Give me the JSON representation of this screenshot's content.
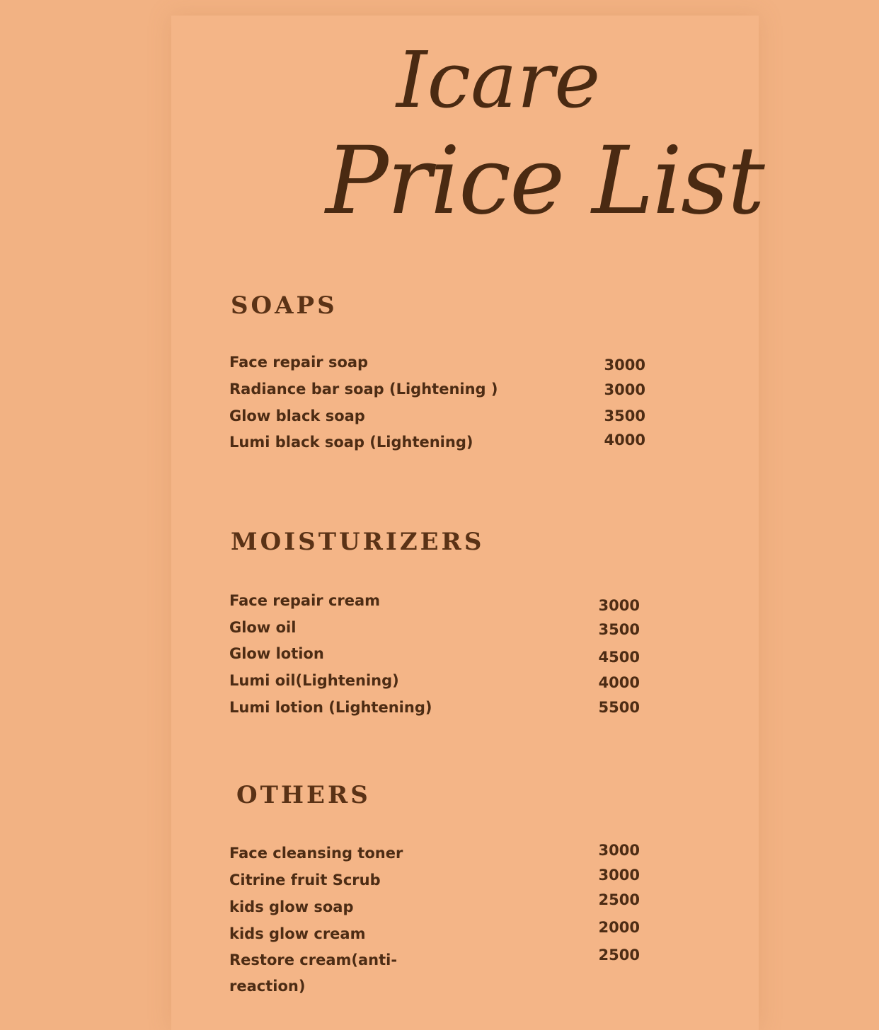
{
  "header": {
    "brand": "Icare",
    "title": "Price List"
  },
  "sections": [
    {
      "title": "SOAPS",
      "items": [
        {
          "name": "Face repair soap",
          "price": "3000"
        },
        {
          "name": "Radiance bar soap (Lightening )",
          "price": "3000"
        },
        {
          "name": "Glow black soap",
          "price": "3500"
        },
        {
          "name": "Lumi black soap (Lightening)",
          "price": "4000"
        }
      ]
    },
    {
      "title": "MOISTURIZERS",
      "items": [
        {
          "name": "Face repair cream",
          "price": "3000"
        },
        {
          "name": "Glow oil",
          "price": "3500"
        },
        {
          "name": "Glow lotion",
          "price": "4500"
        },
        {
          "name": "Lumi oil(Lightening)",
          "price": "4000"
        },
        {
          "name": "Lumi lotion (Lightening)",
          "price": "5500"
        }
      ]
    },
    {
      "title": "OTHERS",
      "items": [
        {
          "name": "Face cleansing toner",
          "price": "3000"
        },
        {
          "name": "Citrine fruit Scrub",
          "price": "3000"
        },
        {
          "name": "kids glow soap",
          "price": "2500"
        },
        {
          "name": "kids glow cream",
          "price": "2000"
        },
        {
          "name": "Restore cream(anti-",
          "price": "2500"
        },
        {
          "name": "reaction)",
          "price": ""
        }
      ]
    }
  ]
}
